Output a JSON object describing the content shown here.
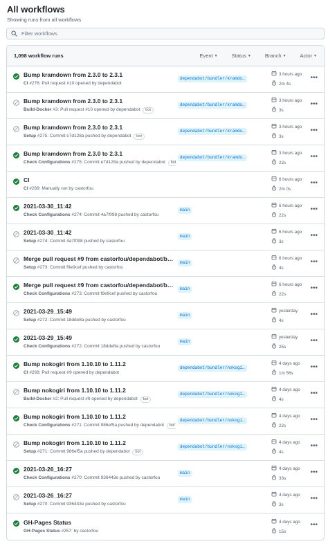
{
  "header": {
    "title": "All workflows",
    "subtitle": "Showing runs from all workflows"
  },
  "filter": {
    "placeholder": "Filter workflows"
  },
  "list_header": {
    "count": "1,098 workflow runs",
    "event": "Event",
    "status": "Status",
    "branch": "Branch",
    "actor": "Actor"
  },
  "runs": [
    {
      "title": "Bump kramdown from 2.3.0 to 2.3.1",
      "status": "success",
      "workflow": "CI",
      "meta": "#276: Pull request #10 opened by dependabot",
      "bot": "",
      "branch": "dependabot/bundler/kramdo…",
      "time": "3 hours ago",
      "duration": "2m 4s"
    },
    {
      "title": "Bump kramdown from 2.3.0 to 2.3.1",
      "status": "skipped",
      "workflow": "Build-Docker",
      "meta": "#3: Pull request #10 opened by dependabot",
      "bot": "bot",
      "branch": "dependabot/bundler/kramdo…",
      "time": "3 hours ago",
      "duration": "3s"
    },
    {
      "title": "Bump kramdown from 2.3.0 to 2.3.1",
      "status": "skipped",
      "workflow": "Setup",
      "meta": "#275: Commit e7d128a pushed by dependabot",
      "bot": "bot",
      "branch": "dependabot/bundler/kramdo…",
      "time": "3 hours ago",
      "duration": "3s"
    },
    {
      "title": "Bump kramdown from 2.3.0 to 2.3.1",
      "status": "success",
      "workflow": "Check Configurations",
      "meta": "#275: Commit e7d128a pushed by dependabot",
      "bot": "bot",
      "branch": "dependabot/bundler/kramdo…",
      "time": "3 hours ago",
      "duration": "22s"
    },
    {
      "title": "CI",
      "status": "success",
      "workflow": "CI",
      "meta": "#269: Manually run by castorfou",
      "bot": "",
      "branch": "",
      "time": "6 hours ago",
      "duration": "2m 0s"
    },
    {
      "title": "2021-03-30_11:42",
      "status": "success",
      "workflow": "Check Configurations",
      "meta": "#274: Commit 4a7f098 pushed by castorfou",
      "bot": "",
      "branch": "main",
      "time": "6 hours ago",
      "duration": "22s"
    },
    {
      "title": "2021-03-30_11:42",
      "status": "skipped",
      "workflow": "Setup",
      "meta": "#274: Commit 4a7f098 pushed by castorfou",
      "bot": "",
      "branch": "main",
      "time": "6 hours ago",
      "duration": "3s"
    },
    {
      "title": "Merge pull request #9 from castorfou/dependabot/b…",
      "status": "skipped",
      "workflow": "Setup",
      "meta": "#273: Commit f9e9cef pushed by castorfou",
      "bot": "",
      "branch": "main",
      "time": "6 hours ago",
      "duration": "4s"
    },
    {
      "title": "Merge pull request #9 from castorfou/dependabot/b…",
      "status": "success",
      "workflow": "Check Configurations",
      "meta": "#273: Commit f9e9cef pushed by castorfou",
      "bot": "",
      "branch": "main",
      "time": "6 hours ago",
      "duration": "22s"
    },
    {
      "title": "2021-03-29_15:49",
      "status": "skipped",
      "workflow": "Setup",
      "meta": "#272: Commit 18dde8a pushed by castorfou",
      "bot": "",
      "branch": "main",
      "time": "yesterday",
      "duration": "4s"
    },
    {
      "title": "2021-03-29_15:49",
      "status": "success",
      "workflow": "Check Configurations",
      "meta": "#272: Commit 18dde8a pushed by castorfou",
      "bot": "",
      "branch": "main",
      "time": "yesterday",
      "duration": "25s"
    },
    {
      "title": "Bump nokogiri from 1.10.10 to 1.11.2",
      "status": "success",
      "workflow": "CI",
      "meta": "#268: Pull request #9 opened by dependabot",
      "bot": "",
      "branch": "dependabot/bundler/nokogi…",
      "time": "4 days ago",
      "duration": "1m 56s"
    },
    {
      "title": "Bump nokogiri from 1.10.10 to 1.11.2",
      "status": "skipped",
      "workflow": "Build-Docker",
      "meta": "#2: Pull request #9 opened by dependabot",
      "bot": "bot",
      "branch": "dependabot/bundler/nokogi…",
      "time": "4 days ago",
      "duration": "4s"
    },
    {
      "title": "Bump nokogiri from 1.10.10 to 1.11.2",
      "status": "success",
      "workflow": "Check Configurations",
      "meta": "#271: Commit 986ef5a pushed by dependabot",
      "bot": "bot",
      "branch": "dependabot/bundler/nokogi…",
      "time": "4 days ago",
      "duration": "22s"
    },
    {
      "title": "Bump nokogiri from 1.10.10 to 1.11.2",
      "status": "skipped",
      "workflow": "Setup",
      "meta": "#271: Commit 986ef5a pushed by dependabot",
      "bot": "bot",
      "branch": "dependabot/bundler/nokogi…",
      "time": "4 days ago",
      "duration": "4s"
    },
    {
      "title": "2021-03-26_16:27",
      "status": "success",
      "workflow": "Check Configurations",
      "meta": "#270: Commit 936443e pushed by castorfou",
      "bot": "",
      "branch": "main",
      "time": "4 days ago",
      "duration": "33s"
    },
    {
      "title": "2021-03-26_16:27",
      "status": "skipped",
      "workflow": "Setup",
      "meta": "#270: Commit 936443e pushed by castorfou",
      "bot": "",
      "branch": "main",
      "time": "4 days ago",
      "duration": "3s"
    },
    {
      "title": "GH-Pages Status",
      "status": "success",
      "workflow": "GH-Pages Status",
      "meta": "#257: by castorfou",
      "bot": "",
      "branch": "",
      "time": "4 days ago",
      "duration": "15s"
    }
  ],
  "colors": {
    "success": "#1a7f37",
    "skipped": "#8c959f",
    "branch_bg": "#ddf4ff",
    "branch_fg": "#0969da"
  },
  "icons": {
    "success": "check-circle-icon",
    "skipped": "skip-icon",
    "time": "calendar-icon",
    "duration": "stopwatch-icon",
    "more": "kebab-horizontal-icon",
    "filter": "search-icon"
  }
}
